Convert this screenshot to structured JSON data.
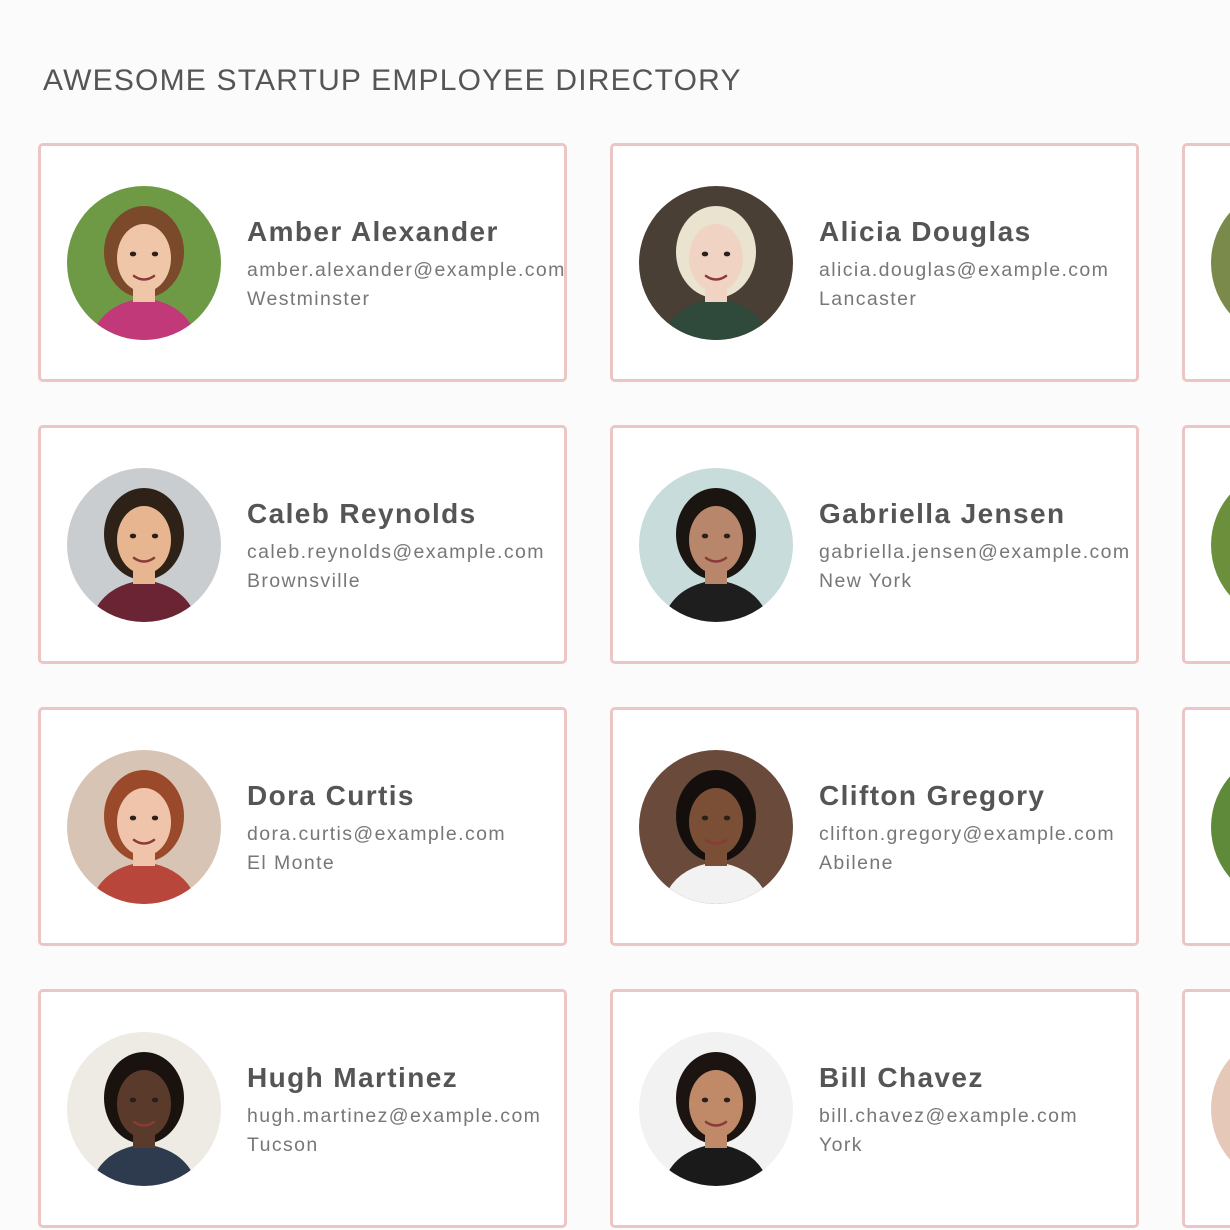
{
  "header": {
    "title": "AWESOME STARTUP EMPLOYEE DIRECTORY"
  },
  "employees": [
    {
      "name": "Amber Alexander",
      "email": "amber.alexander@example.com",
      "city": "Westminster",
      "avatar": {
        "bg": "#6f9a45",
        "skin": "#f0c6a8",
        "hair": "#7a4a2a",
        "shirt": "#c2397a"
      }
    },
    {
      "name": "Alicia Douglas",
      "email": "alicia.douglas@example.com",
      "city": "Lancaster",
      "avatar": {
        "bg": "#4a3f35",
        "skin": "#f1d3c3",
        "hair": "#e9e3d0",
        "shirt": "#2f4a3a"
      }
    },
    {
      "name": "",
      "email": "",
      "city": "",
      "avatar": {
        "bg": "#7a8a4a",
        "skin": "#e2b48e",
        "hair": "#3a2a1c",
        "shirt": "#3e4c7a"
      }
    },
    {
      "name": "Caleb Reynolds",
      "email": "caleb.reynolds@example.com",
      "city": "Brownsville",
      "avatar": {
        "bg": "#c9cdd0",
        "skin": "#e7b691",
        "hair": "#2e2218",
        "shirt": "#6a2433"
      }
    },
    {
      "name": "Gabriella Jensen",
      "email": "gabriella.jensen@example.com",
      "city": "New York",
      "avatar": {
        "bg": "#c9dcdc",
        "skin": "#b8866a",
        "hair": "#1b1512",
        "shirt": "#1e1e1e"
      }
    },
    {
      "name": "",
      "email": "",
      "city": "",
      "avatar": {
        "bg": "#6b8f3a",
        "skin": "#e0b08a",
        "hair": "#3a2b1d",
        "shirt": "#556b2f"
      }
    },
    {
      "name": "Dora Curtis",
      "email": "dora.curtis@example.com",
      "city": "El Monte",
      "avatar": {
        "bg": "#d8c4b4",
        "skin": "#f0c4aa",
        "hair": "#9a4a2a",
        "shirt": "#b9463a"
      }
    },
    {
      "name": "Clifton Gregory",
      "email": "clifton.gregory@example.com",
      "city": "Abilene",
      "avatar": {
        "bg": "#6a4a3a",
        "skin": "#7a4f35",
        "hair": "#140f0c",
        "shirt": "#f2f2f2"
      }
    },
    {
      "name": "",
      "email": "",
      "city": "",
      "avatar": {
        "bg": "#5f8a3a",
        "skin": "#efc9a8",
        "hair": "#e5d59a",
        "shirt": "#4a6a2a"
      }
    },
    {
      "name": "Hugh Martinez",
      "email": "hugh.martinez@example.com",
      "city": "Tucson",
      "avatar": {
        "bg": "#eeeae4",
        "skin": "#5a3a2a",
        "hair": "#1a120e",
        "shirt": "#2e3a4e"
      }
    },
    {
      "name": "Bill Chavez",
      "email": "bill.chavez@example.com",
      "city": "York",
      "avatar": {
        "bg": "#f2f2f2",
        "skin": "#c08a68",
        "hair": "#1c1410",
        "shirt": "#1a1a1a"
      }
    },
    {
      "name": "",
      "email": "",
      "city": "",
      "avatar": {
        "bg": "#e6c8b8",
        "skin": "#e9bfa3",
        "hair": "#6a4a3a",
        "shirt": "#8a6a5a"
      }
    }
  ]
}
